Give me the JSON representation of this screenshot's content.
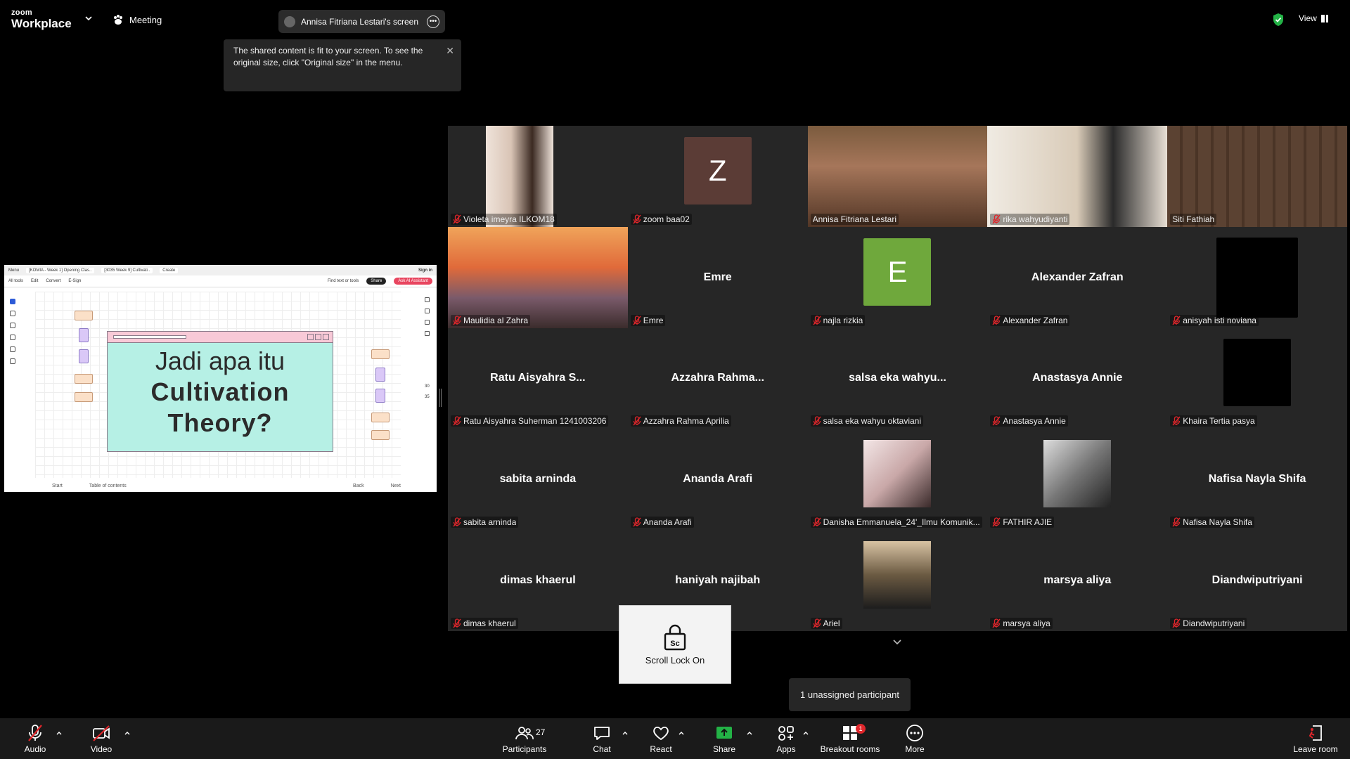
{
  "app": {
    "brand_top": "zoom",
    "brand_bottom": "Workplace",
    "meeting_label": "Meeting",
    "share_indicator": "Annisa Fitriana Lestari's screen",
    "view_label": "View"
  },
  "tooltip": {
    "text": "The shared content is fit to your screen. To see the original size, click \"Original size\" in the menu."
  },
  "shared_screen": {
    "menu_btn": "Menu",
    "tab1": "[KOMIA - Week 1] Opening Clas..",
    "tab2": "[3035 Week 9] Cultivati..",
    "new_tab": "Create",
    "signin": "Sign in",
    "menu_all_tools": "All tools",
    "menu_edit": "Edit",
    "menu_convert": "Convert",
    "menu_esign": "E-Sign",
    "find_text": "Find text or tools",
    "share_btn": "Share",
    "ai_btn": "Ask AI Assistant",
    "slide_line1": "Jadi apa itu",
    "slide_line2": "Cultivation",
    "slide_line3": "Theory?",
    "zoom_top": "30",
    "zoom_bottom": "35",
    "foot_start": "Start",
    "foot_toc": "Table of contents",
    "foot_back": "Back",
    "foot_next": "Next"
  },
  "gallery": {
    "tiles": [
      {
        "label": "Violeta imeyra ILKOM18",
        "kind": "photo",
        "muted": true
      },
      {
        "label": "zoom baa02",
        "kind": "letter",
        "letter": "Z",
        "color": "#5b3c36",
        "muted": true
      },
      {
        "label": "Annisa Fitriana Lestari",
        "kind": "photo",
        "muted": false
      },
      {
        "label": "rika wahyudiyanti",
        "kind": "photo",
        "muted": true
      },
      {
        "label": "Siti Fathiah",
        "kind": "photo",
        "muted": false,
        "active": true
      },
      {
        "label": "Maulidia al Zahra",
        "kind": "photo",
        "muted": true
      },
      {
        "label": "Emre",
        "display": "Emre",
        "kind": "name",
        "muted": true
      },
      {
        "label": "najla rizkia",
        "kind": "letter",
        "letter": "E",
        "color": "#6fa83c",
        "muted": true
      },
      {
        "label": "Alexander Zafran",
        "display": "Alexander Zafran",
        "kind": "name",
        "muted": true
      },
      {
        "label": "anisyah isti noviana",
        "kind": "black",
        "muted": true
      },
      {
        "label": "Ratu Aisyahra Suherman 1241003206",
        "display": "Ratu Aisyahra S...",
        "kind": "name",
        "muted": true
      },
      {
        "label": "Azzahra Rahma Aprilia",
        "display": "Azzahra Rahma...",
        "kind": "name",
        "muted": true
      },
      {
        "label": "salsa eka wahyu oktaviani",
        "display": "salsa eka wahyu...",
        "kind": "name",
        "muted": true
      },
      {
        "label": "Anastasya Annie",
        "display": "Anastasya Annie",
        "kind": "name",
        "muted": true
      },
      {
        "label": "Khaira Tertia pasya",
        "kind": "black-sm",
        "muted": true
      },
      {
        "label": "sabita arninda",
        "display": "sabita arninda",
        "kind": "name",
        "muted": true
      },
      {
        "label": "Ananda Arafi",
        "display": "Ananda Arafi",
        "kind": "name",
        "muted": true
      },
      {
        "label": "Danisha Emmanuela_24'_Ilmu Komunik...",
        "kind": "photo-sq",
        "muted": true
      },
      {
        "label": "FATHIR AJIE",
        "kind": "photo-sq",
        "muted": true
      },
      {
        "label": "Nafisa Nayla Shifa",
        "display": "Nafisa Nayla Shifa",
        "kind": "name",
        "muted": true
      },
      {
        "label": "dimas khaerul",
        "display": "dimas khaerul",
        "kind": "name",
        "muted": true
      },
      {
        "label": "",
        "display": "haniyah najibah",
        "kind": "name",
        "muted": false
      },
      {
        "label": "Ariel",
        "kind": "photo-sq",
        "muted": true
      },
      {
        "label": "marsya aliya",
        "display": "marsya aliya",
        "kind": "name",
        "muted": true
      },
      {
        "label": "Diandwiputriyani",
        "display": "Diandwiputriyani",
        "kind": "name",
        "muted": true
      }
    ]
  },
  "scroll_lock": {
    "icon_text": "Sc",
    "label": "Scroll Lock On"
  },
  "unassigned": "1 unassigned participant",
  "toolbar": {
    "audio": "Audio",
    "video": "Video",
    "participants": "Participants",
    "participant_count": "27",
    "chat": "Chat",
    "react": "React",
    "share": "Share",
    "apps": "Apps",
    "breakout": "Breakout rooms",
    "breakout_badge": "1",
    "more": "More",
    "leave": "Leave room"
  },
  "colors": {
    "active_border": "#2ecc71",
    "share_green": "#23b246",
    "mute_red": "#e0262b",
    "ai_button": "#e8455f"
  }
}
